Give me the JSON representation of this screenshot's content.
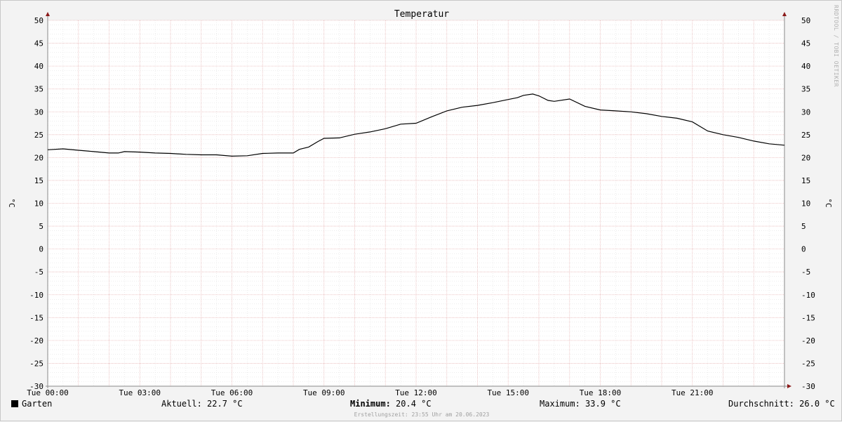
{
  "chart_data": {
    "type": "line",
    "title": "Temperatur",
    "ylabel": "°C",
    "ylim": [
      -30,
      50
    ],
    "yticks": [
      50,
      45,
      40,
      35,
      30,
      25,
      20,
      15,
      10,
      5,
      0,
      -5,
      -10,
      -15,
      -20,
      -25,
      -30
    ],
    "xlim": [
      0,
      24
    ],
    "xticks": [
      {
        "x": 0,
        "label": "Tue 00:00"
      },
      {
        "x": 3,
        "label": "Tue 03:00"
      },
      {
        "x": 6,
        "label": "Tue 06:00"
      },
      {
        "x": 9,
        "label": "Tue 09:00"
      },
      {
        "x": 12,
        "label": "Tue 12:00"
      },
      {
        "x": 15,
        "label": "Tue 15:00"
      },
      {
        "x": 18,
        "label": "Tue 18:00"
      },
      {
        "x": 21,
        "label": "Tue 21:00"
      }
    ],
    "grid": true,
    "series": [
      {
        "name": "Garten",
        "color": "#000000",
        "x": [
          0,
          0.5,
          1,
          1.5,
          2,
          2.3,
          2.5,
          3,
          3.5,
          4,
          4.5,
          5,
          5.5,
          6,
          6.5,
          7,
          7.5,
          8,
          8.2,
          8.5,
          8.8,
          9,
          9.5,
          10,
          10.5,
          11,
          11.5,
          12,
          12.5,
          13,
          13.5,
          14,
          14.5,
          15,
          15.3,
          15.5,
          15.8,
          16,
          16.3,
          16.5,
          17,
          17.5,
          18,
          18.5,
          19,
          19.5,
          20,
          20.5,
          21,
          21.5,
          22,
          22.5,
          23,
          23.5,
          24
        ],
        "y": [
          21.7,
          21.9,
          21.6,
          21.3,
          21.0,
          21.0,
          21.3,
          21.2,
          21.0,
          20.9,
          20.7,
          20.6,
          20.6,
          20.3,
          20.4,
          20.9,
          21.0,
          21.0,
          21.8,
          22.3,
          23.5,
          24.2,
          24.3,
          25.1,
          25.6,
          26.3,
          27.3,
          27.5,
          28.9,
          30.2,
          31.0,
          31.4,
          32.0,
          32.7,
          33.1,
          33.6,
          33.9,
          33.5,
          32.5,
          32.3,
          32.8,
          31.2,
          30.4,
          30.2,
          30.0,
          29.6,
          29.0,
          28.6,
          27.8,
          25.8,
          25.0,
          24.4,
          23.6,
          23.0,
          22.7
        ]
      }
    ]
  },
  "legend": {
    "series_name": "Garten",
    "current": "Aktuell: 22.7 °C",
    "minimum_label": "Minimum:",
    "minimum_value": " 20.4 °C",
    "maximum": "Maximum: 33.9 °C",
    "average": "Durchschnitt: 26.0 °C"
  },
  "footer": "Erstellungszeit: 23:55 Uhr am 20.06.2023",
  "watermark": "RRDTOOL / TOBI OETIKER"
}
